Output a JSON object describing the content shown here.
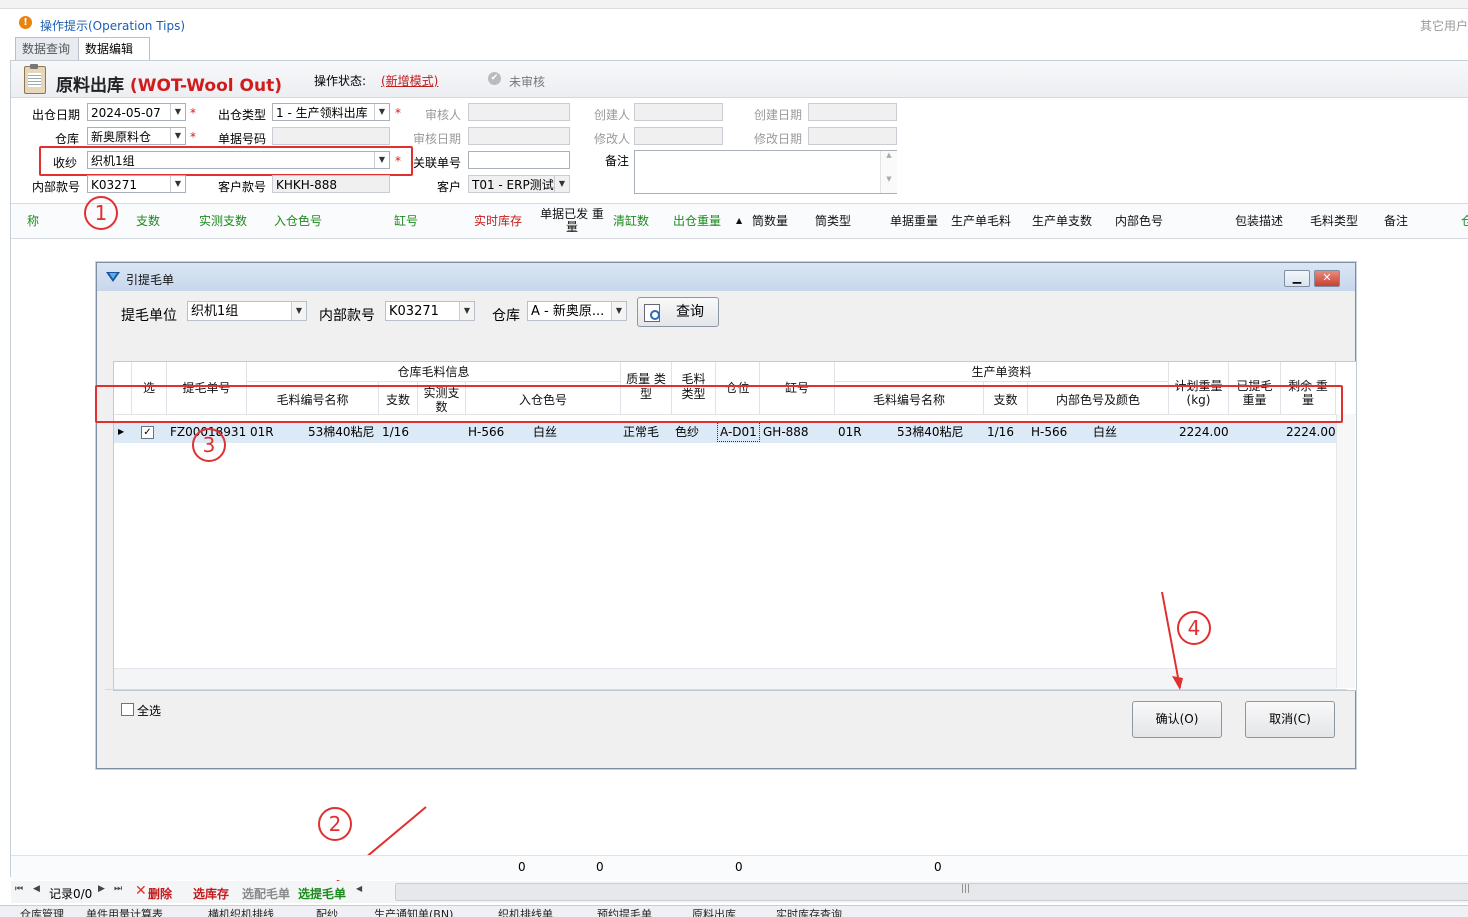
{
  "tip": {
    "text": "操作提示(Operation Tips)",
    "right_text": "其它用户"
  },
  "tabs": [
    {
      "label": "数据查询"
    },
    {
      "label": "数据编辑"
    }
  ],
  "page": {
    "title_cn": "原料出库",
    "title_en": "(WOT-Wool Out)",
    "status_label": "操作状态:",
    "status_value": "(新增模式)",
    "audit_label": "未审核"
  },
  "form": {
    "out_date": {
      "label": "出仓日期",
      "value": "2024-05-07"
    },
    "out_type": {
      "label": "出仓类型",
      "value": "1 - 生产领料出库"
    },
    "auditor": {
      "label": "审核人"
    },
    "creator": {
      "label": "创建人"
    },
    "create_date": {
      "label": "创建日期"
    },
    "warehouse": {
      "label": "仓库",
      "value": "新奥原料仓"
    },
    "doc_no": {
      "label": "单据号码"
    },
    "audit_date": {
      "label": "审核日期"
    },
    "modifier": {
      "label": "修改人"
    },
    "modify_date": {
      "label": "修改日期"
    },
    "receiver": {
      "label": "收纱",
      "value": "织机1组"
    },
    "related_doc": {
      "label": "关联单号"
    },
    "remark": {
      "label": "备注"
    },
    "style_no": {
      "label": "内部款号",
      "value": "K03271"
    },
    "customer_style": {
      "label": "客户款号",
      "value": "KHKH-888"
    },
    "customer": {
      "label": "客户",
      "value": "T01 - ERP测试"
    }
  },
  "main_grid_headers": [
    "称",
    "支数",
    "实测支数",
    "入仓色号",
    "缸号",
    "实时库存",
    "单据已发 重量",
    "清缸数",
    "出仓重量",
    "筒数量",
    "筒类型",
    "单据重量",
    "生产单毛料",
    "生产单支数",
    "内部色号",
    "包装描述",
    "毛料类型",
    "备注",
    "仓"
  ],
  "annotations": [
    "1",
    "2",
    "3",
    "4"
  ],
  "dialog": {
    "title": "引提毛单",
    "filter": {
      "unit_label": "提毛单位",
      "unit_value": "织机1组",
      "style_label": "内部款号",
      "style_value": "K03271",
      "wh_label": "仓库",
      "wh_value": "A - 新奥原...",
      "query_label": "查询"
    },
    "headers": {
      "select": "选",
      "doc_no": "提毛单号",
      "group_wh": "仓库毛料信息",
      "wool_name": "毛料编号名称",
      "count": "支数",
      "measured": "实测支数",
      "in_color": "入仓色号",
      "quality": "质量 类型",
      "wool_type": "毛料类型",
      "location": "仓位",
      "batch": "缸号",
      "group_prod": "生产单资料",
      "p_wool_name": "毛料编号名称",
      "p_count": "支数",
      "inner_color": "内部色号及颜色",
      "plan_weight": "计划重量(kg)",
      "taken_weight": "已提毛 重量",
      "remain_weight": "剩余 重量"
    },
    "row": {
      "doc_no": "FZ00018931",
      "wool_code": "01R",
      "wool_name": "53棉40粘尼",
      "count": "1/16",
      "measured": "",
      "color_code": "H-566",
      "color_name": "白丝",
      "quality": "正常毛",
      "wool_type": "色纱",
      "location": "A-D01",
      "batch": "GH-888",
      "p_wool_code": "01R",
      "p_wool_name": "53棉40粘尼",
      "p_count": "1/16",
      "p_color_code": "H-566",
      "p_color_name": "白丝",
      "plan_weight": "2224.00",
      "taken_weight": "",
      "remain_weight": "2224.00"
    },
    "select_all": "全选",
    "confirm": "确认(O)",
    "cancel": "取消(C)"
  },
  "totals": [
    "0",
    "0",
    "0",
    "0"
  ],
  "nav": {
    "record": "记录0/0",
    "delete": "删除",
    "stock": "选库存",
    "match": "选配毛单",
    "pick": "选提毛单"
  },
  "bottom_tabs": [
    "仓库管理",
    "单件用量计算表",
    "横机织机排线",
    "配纱",
    "生产通知单(BN)",
    "织机排线单",
    "预约提毛单",
    "原料出库",
    "实时库存查询"
  ]
}
